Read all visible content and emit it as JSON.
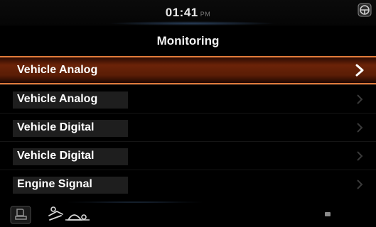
{
  "status": {
    "time": "01:41",
    "ampm": "PM"
  },
  "header": {
    "title": "Monitoring"
  },
  "menu": {
    "items": [
      {
        "label": "Vehicle Analog",
        "selected": true
      },
      {
        "label": "Vehicle Analog",
        "selected": false
      },
      {
        "label": "Vehicle Digital",
        "selected": false
      },
      {
        "label": "Vehicle Digital",
        "selected": false
      },
      {
        "label": "Engine Signal",
        "selected": false
      }
    ]
  },
  "colors": {
    "accent": "#e07a3a",
    "selected_bg": "#6b2308"
  },
  "icons": {
    "status_corner": "steering-wheel-icon",
    "bottom_left": "seat-icon",
    "bottom_mid": "operator-turtle-icon",
    "bottom_right": "small-indicator-icon",
    "chevron": "chevron-right-icon"
  }
}
